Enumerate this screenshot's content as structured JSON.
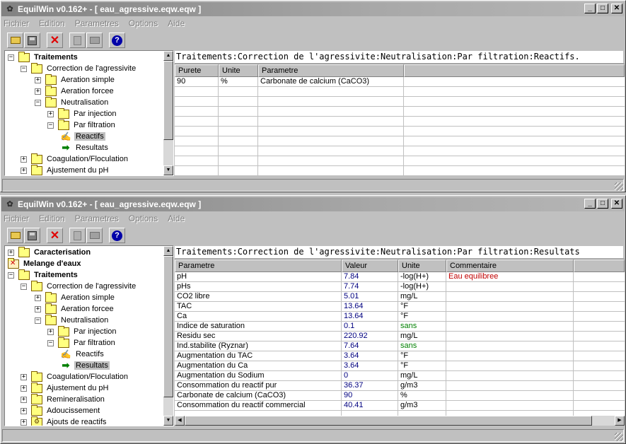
{
  "windows": [
    {
      "title": "EquilWin v0.162+ - [ eau_agressive.eqw.eqw ]",
      "menu": [
        "Fichier",
        "Edition",
        "Parametres",
        "Options",
        "Aide"
      ],
      "path": "Traitements:Correction de l'agressivite:Neutralisation:Par filtration:Reactifs.",
      "tree": [
        {
          "label": "Traitements",
          "bold": true,
          "level": 0,
          "toggle": "-",
          "icon": "folder"
        },
        {
          "label": "Correction de l'agressivite",
          "level": 1,
          "toggle": "-",
          "icon": "folder"
        },
        {
          "label": "Aeration simple",
          "level": 2,
          "toggle": "+",
          "icon": "folder"
        },
        {
          "label": "Aeration forcee",
          "level": 2,
          "toggle": "+",
          "icon": "folder"
        },
        {
          "label": "Neutralisation",
          "level": 2,
          "toggle": "-",
          "icon": "folder"
        },
        {
          "label": "Par injection",
          "level": 3,
          "toggle": "+",
          "icon": "folder"
        },
        {
          "label": "Par filtration",
          "level": 3,
          "toggle": "-",
          "icon": "folder"
        },
        {
          "label": "Reactifs",
          "level": 4,
          "icon": "edit",
          "selected": true
        },
        {
          "label": "Resultats",
          "level": 4,
          "icon": "arrow"
        },
        {
          "label": "Coagulation/Floculation",
          "level": 1,
          "toggle": "+",
          "icon": "folder"
        },
        {
          "label": "Ajustement du pH",
          "level": 1,
          "toggle": "+",
          "icon": "folder"
        }
      ],
      "columns": [
        "Purete",
        "Unite",
        "Parametre"
      ],
      "rows": [
        [
          "90",
          "%",
          "Carbonate de calcium (CaCO3)"
        ]
      ]
    },
    {
      "title": "EquilWin v0.162+ - [ eau_agressive.eqw.eqw ]",
      "menu": [
        "Fichier",
        "Edition",
        "Parametres",
        "Options",
        "Aide"
      ],
      "path": "Traitements:Correction de l'agressivite:Neutralisation:Par filtration:Resultats",
      "tree": [
        {
          "label": "Caracterisation",
          "bold": true,
          "level": 0,
          "toggle": "+",
          "icon": "folder"
        },
        {
          "label": "Melange d'eaux",
          "bold": true,
          "level": 0,
          "icon": "folder-x"
        },
        {
          "label": "Traitements",
          "bold": true,
          "level": 0,
          "toggle": "-",
          "icon": "folder"
        },
        {
          "label": "Correction de l'agressivite",
          "level": 1,
          "toggle": "-",
          "icon": "folder"
        },
        {
          "label": "Aeration simple",
          "level": 2,
          "toggle": "+",
          "icon": "folder"
        },
        {
          "label": "Aeration forcee",
          "level": 2,
          "toggle": "+",
          "icon": "folder"
        },
        {
          "label": "Neutralisation",
          "level": 2,
          "toggle": "-",
          "icon": "folder"
        },
        {
          "label": "Par injection",
          "level": 3,
          "toggle": "+",
          "icon": "folder"
        },
        {
          "label": "Par filtration",
          "level": 3,
          "toggle": "-",
          "icon": "folder"
        },
        {
          "label": "Reactifs",
          "level": 4,
          "icon": "edit"
        },
        {
          "label": "Resultats",
          "level": 4,
          "icon": "arrow",
          "selected": true
        },
        {
          "label": "Coagulation/Floculation",
          "level": 1,
          "toggle": "+",
          "icon": "folder"
        },
        {
          "label": "Ajustement du pH",
          "level": 1,
          "toggle": "+",
          "icon": "folder"
        },
        {
          "label": "Remineralisation",
          "level": 1,
          "toggle": "+",
          "icon": "folder"
        },
        {
          "label": "Adoucissement",
          "level": 1,
          "toggle": "+",
          "icon": "folder"
        },
        {
          "label": "Ajouts de reactifs",
          "level": 1,
          "toggle": "+",
          "icon": "folder-gear"
        }
      ],
      "columns": [
        "Parametre",
        "Valeur",
        "Unite",
        "Commentaire"
      ],
      "rows": [
        [
          "pH",
          "7.84",
          "-log(H+)",
          "Eau equilibree"
        ],
        [
          "pHs",
          "7.74",
          "-log(H+)",
          ""
        ],
        [
          "CO2 libre",
          "5.01",
          "mg/L",
          ""
        ],
        [
          "TAC",
          "13.64",
          "°F",
          ""
        ],
        [
          "Ca",
          "13.64",
          "°F",
          ""
        ],
        [
          "Indice de saturation",
          "0.1",
          "sans",
          ""
        ],
        [
          "Residu sec",
          "220.92",
          "mg/L",
          ""
        ],
        [
          "Ind.stabilite (Ryznar)",
          "7.64",
          "sans",
          ""
        ],
        [
          "Augmentation du TAC",
          "3.64",
          "°F",
          ""
        ],
        [
          "Augmentation du Ca",
          "3.64",
          "°F",
          ""
        ],
        [
          "Augmentation du Sodium",
          "0",
          "mg/L",
          ""
        ],
        [
          "Consommation du reactif pur",
          "36.37",
          "g/m3",
          ""
        ],
        [
          "Carbonate de calcium (CaCO3)",
          "90",
          "%",
          ""
        ],
        [
          "Consommation du reactif commercial",
          "40.41",
          "g/m3",
          ""
        ]
      ]
    }
  ],
  "colors": {
    "value_text": "#000080",
    "unit_sans": "#008000",
    "comment": "#c00000",
    "titlebar": "#828282"
  }
}
